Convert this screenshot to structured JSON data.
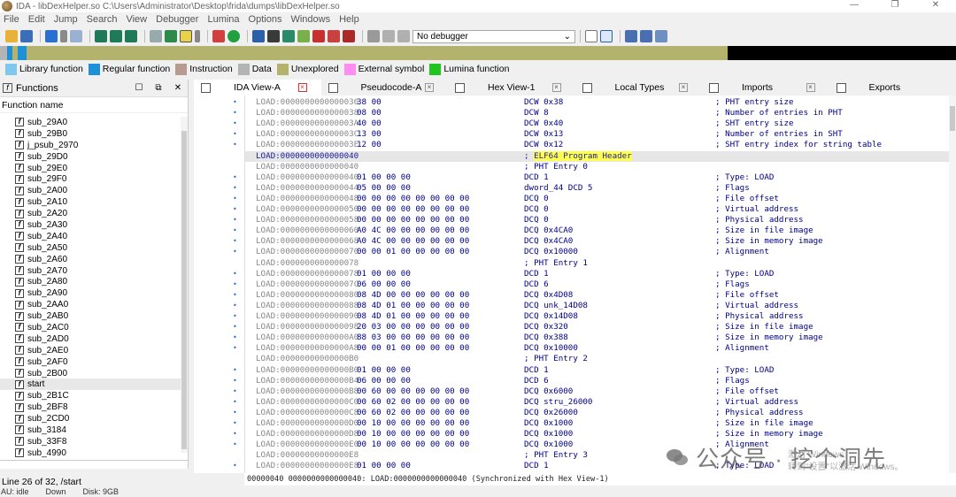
{
  "window": {
    "title": "IDA - libDexHelper.so C:\\Users\\Administrator\\Desktop\\frida\\dumps\\libDexHelper.so",
    "controls": [
      "—",
      "❐",
      "✕"
    ]
  },
  "menu": [
    "File",
    "Edit",
    "Jump",
    "Search",
    "View",
    "Debugger",
    "Lumina",
    "Options",
    "Windows",
    "Help"
  ],
  "toolbar": {
    "debugger_value": "No debugger"
  },
  "legend": [
    {
      "label": "Library function",
      "color": "#7ec8f0"
    },
    {
      "label": "Regular function",
      "color": "#1e90d8"
    },
    {
      "label": "Instruction",
      "color": "#b89a90"
    },
    {
      "label": "Data",
      "color": "#b4b4b4"
    },
    {
      "label": "Unexplored",
      "color": "#b3b36e"
    },
    {
      "label": "External symbol",
      "color": "#ff8cf0"
    },
    {
      "label": "Lumina function",
      "color": "#22c422"
    }
  ],
  "functions": {
    "title": "Functions",
    "column": "Function name",
    "items": [
      "sub_29A0",
      "sub_29B0",
      "j_psub_2970",
      "sub_29D0",
      "sub_29E0",
      "sub_29F0",
      "sub_2A00",
      "sub_2A10",
      "sub_2A20",
      "sub_2A30",
      "sub_2A40",
      "sub_2A50",
      "sub_2A60",
      "sub_2A70",
      "sub_2A80",
      "sub_2A90",
      "sub_2AA0",
      "sub_2AB0",
      "sub_2AC0",
      "sub_2AD0",
      "sub_2AE0",
      "sub_2AF0",
      "sub_2B00",
      "start",
      "sub_2B1C",
      "sub_2BF8",
      "sub_2CD0",
      "sub_3184",
      "sub_33F8",
      "sub_4990"
    ],
    "status": "Line 26 of 32, /start"
  },
  "tabs": [
    "IDA View-A",
    "Pseudocode-A",
    "Hex View-1",
    "Local Types",
    "Imports",
    "Exports"
  ],
  "listing": [
    {
      "dot": true,
      "addr": "LOAD:0000000000000036",
      "bytes": "38 00",
      "instr": "DCW 0x38",
      "cmt": "; PHT entry size"
    },
    {
      "dot": true,
      "addr": "LOAD:0000000000000038",
      "bytes": "08 00",
      "instr": "DCW 8",
      "cmt": "; Number of entries in PHT"
    },
    {
      "dot": true,
      "addr": "LOAD:000000000000003A",
      "bytes": "40 00",
      "instr": "DCW 0x40",
      "cmt": "; SHT entry size"
    },
    {
      "dot": true,
      "addr": "LOAD:000000000000003C",
      "bytes": "13 00",
      "instr": "DCW 0x13",
      "cmt": "; Number of entries in SHT"
    },
    {
      "dot": true,
      "addr": "LOAD:000000000000003E",
      "bytes": "12 00",
      "instr": "DCW 0x12",
      "cmt": "; SHT entry index for string table"
    },
    {
      "dot": false,
      "addr": "LOAD:0000000000000040",
      "bytes": "",
      "instr": "; ELF64 Program Header",
      "cmt": "",
      "hl": true,
      "header": true
    },
    {
      "dot": false,
      "addr": "LOAD:0000000000000040",
      "bytes": "",
      "instr": "; PHT Entry 0",
      "cmt": ""
    },
    {
      "dot": true,
      "addr": "LOAD:0000000000000040",
      "bytes": "01 00 00 00",
      "instr": "DCD 1",
      "cmt": "; Type: LOAD"
    },
    {
      "dot": true,
      "addr": "LOAD:0000000000000044",
      "bytes": "05 00 00 00",
      "instr": "dword_44 DCD 5",
      "cmt": "; Flags"
    },
    {
      "dot": true,
      "addr": "LOAD:0000000000000048",
      "bytes": "00 00 00 00 00 00 00 00",
      "instr": "DCQ 0",
      "cmt": "; File offset"
    },
    {
      "dot": true,
      "addr": "LOAD:0000000000000050",
      "bytes": "00 00 00 00 00 00 00 00",
      "instr": "DCQ 0",
      "cmt": "; Virtual address"
    },
    {
      "dot": true,
      "addr": "LOAD:0000000000000058",
      "bytes": "00 00 00 00 00 00 00 00",
      "instr": "DCQ 0",
      "cmt": "; Physical address"
    },
    {
      "dot": true,
      "addr": "LOAD:0000000000000060",
      "bytes": "A0 4C 00 00 00 00 00 00",
      "instr": "DCQ 0x4CA0",
      "cmt": "; Size in file image"
    },
    {
      "dot": true,
      "addr": "LOAD:0000000000000068",
      "bytes": "A0 4C 00 00 00 00 00 00",
      "instr": "DCQ 0x4CA0",
      "cmt": "; Size in memory image"
    },
    {
      "dot": true,
      "addr": "LOAD:0000000000000070",
      "bytes": "00 00 01 00 00 00 00 00",
      "instr": "DCQ 0x10000",
      "cmt": "; Alignment"
    },
    {
      "dot": false,
      "addr": "LOAD:0000000000000078",
      "bytes": "",
      "instr": "; PHT Entry 1",
      "cmt": ""
    },
    {
      "dot": true,
      "addr": "LOAD:0000000000000078",
      "bytes": "01 00 00 00",
      "instr": "DCD 1",
      "cmt": "; Type: LOAD"
    },
    {
      "dot": true,
      "addr": "LOAD:000000000000007C",
      "bytes": "06 00 00 00",
      "instr": "DCD 6",
      "cmt": "; Flags"
    },
    {
      "dot": true,
      "addr": "LOAD:0000000000000080",
      "bytes": "08 4D 00 00 00 00 00 00",
      "instr": "DCQ 0x4D08",
      "cmt": "; File offset"
    },
    {
      "dot": true,
      "addr": "LOAD:0000000000000088",
      "bytes": "08 4D 01 00 00 00 00 00",
      "instr": "DCQ unk_14D08",
      "cmt": "; Virtual address"
    },
    {
      "dot": true,
      "addr": "LOAD:0000000000000090",
      "bytes": "08 4D 01 00 00 00 00 00",
      "instr": "DCQ 0x14D08",
      "cmt": "; Physical address"
    },
    {
      "dot": true,
      "addr": "LOAD:0000000000000098",
      "bytes": "20 03 00 00 00 00 00 00",
      "instr": "DCQ 0x320",
      "cmt": "; Size in file image"
    },
    {
      "dot": true,
      "addr": "LOAD:00000000000000A0",
      "bytes": "88 03 00 00 00 00 00 00",
      "instr": "DCQ 0x388",
      "cmt": "; Size in memory image"
    },
    {
      "dot": true,
      "addr": "LOAD:00000000000000A8",
      "bytes": "00 00 01 00 00 00 00 00",
      "instr": "DCQ 0x10000",
      "cmt": "; Alignment"
    },
    {
      "dot": false,
      "addr": "LOAD:00000000000000B0",
      "bytes": "",
      "instr": "; PHT Entry 2",
      "cmt": ""
    },
    {
      "dot": true,
      "addr": "LOAD:00000000000000B0",
      "bytes": "01 00 00 00",
      "instr": "DCD 1",
      "cmt": "; Type: LOAD"
    },
    {
      "dot": true,
      "addr": "LOAD:00000000000000B4",
      "bytes": "06 00 00 00",
      "instr": "DCD 6",
      "cmt": "; Flags"
    },
    {
      "dot": true,
      "addr": "LOAD:00000000000000B8",
      "bytes": "00 60 00 00 00 00 00 00",
      "instr": "DCQ 0x6000",
      "cmt": "; File offset"
    },
    {
      "dot": true,
      "addr": "LOAD:00000000000000C0",
      "bytes": "00 60 02 00 00 00 00 00",
      "instr": "DCQ stru_26000",
      "cmt": "; Virtual address"
    },
    {
      "dot": true,
      "addr": "LOAD:00000000000000C8",
      "bytes": "00 60 02 00 00 00 00 00",
      "instr": "DCQ 0x26000",
      "cmt": "; Physical address"
    },
    {
      "dot": true,
      "addr": "LOAD:00000000000000D0",
      "bytes": "00 10 00 00 00 00 00 00",
      "instr": "DCQ 0x1000",
      "cmt": "; Size in file image"
    },
    {
      "dot": true,
      "addr": "LOAD:00000000000000D8",
      "bytes": "00 10 00 00 00 00 00 00",
      "instr": "DCQ 0x1000",
      "cmt": "; Size in memory image"
    },
    {
      "dot": true,
      "addr": "LOAD:00000000000000E0",
      "bytes": "00 10 00 00 00 00 00 00",
      "instr": "DCQ 0x1000",
      "cmt": "; Alignment"
    },
    {
      "dot": false,
      "addr": "LOAD:00000000000000E8",
      "bytes": "",
      "instr": "; PHT Entry 3",
      "cmt": ""
    },
    {
      "dot": true,
      "addr": "LOAD:00000000000000E8",
      "bytes": "01 00 00 00",
      "instr": "DCD 1",
      "cmt": "; Type: LOAD"
    }
  ],
  "infobar": "00000040 0000000000000040: LOAD:0000000000000040 (Synchronized with Hex View-1)",
  "status": {
    "au": "AU:  idle",
    "down": "Down",
    "disk": "Disk: 9GB"
  },
  "watermark": {
    "text": "公众号 · 挖个洞先",
    "activate1": "激活 Windows",
    "activate2": "转到\"设置\"以激活 Windows。"
  }
}
